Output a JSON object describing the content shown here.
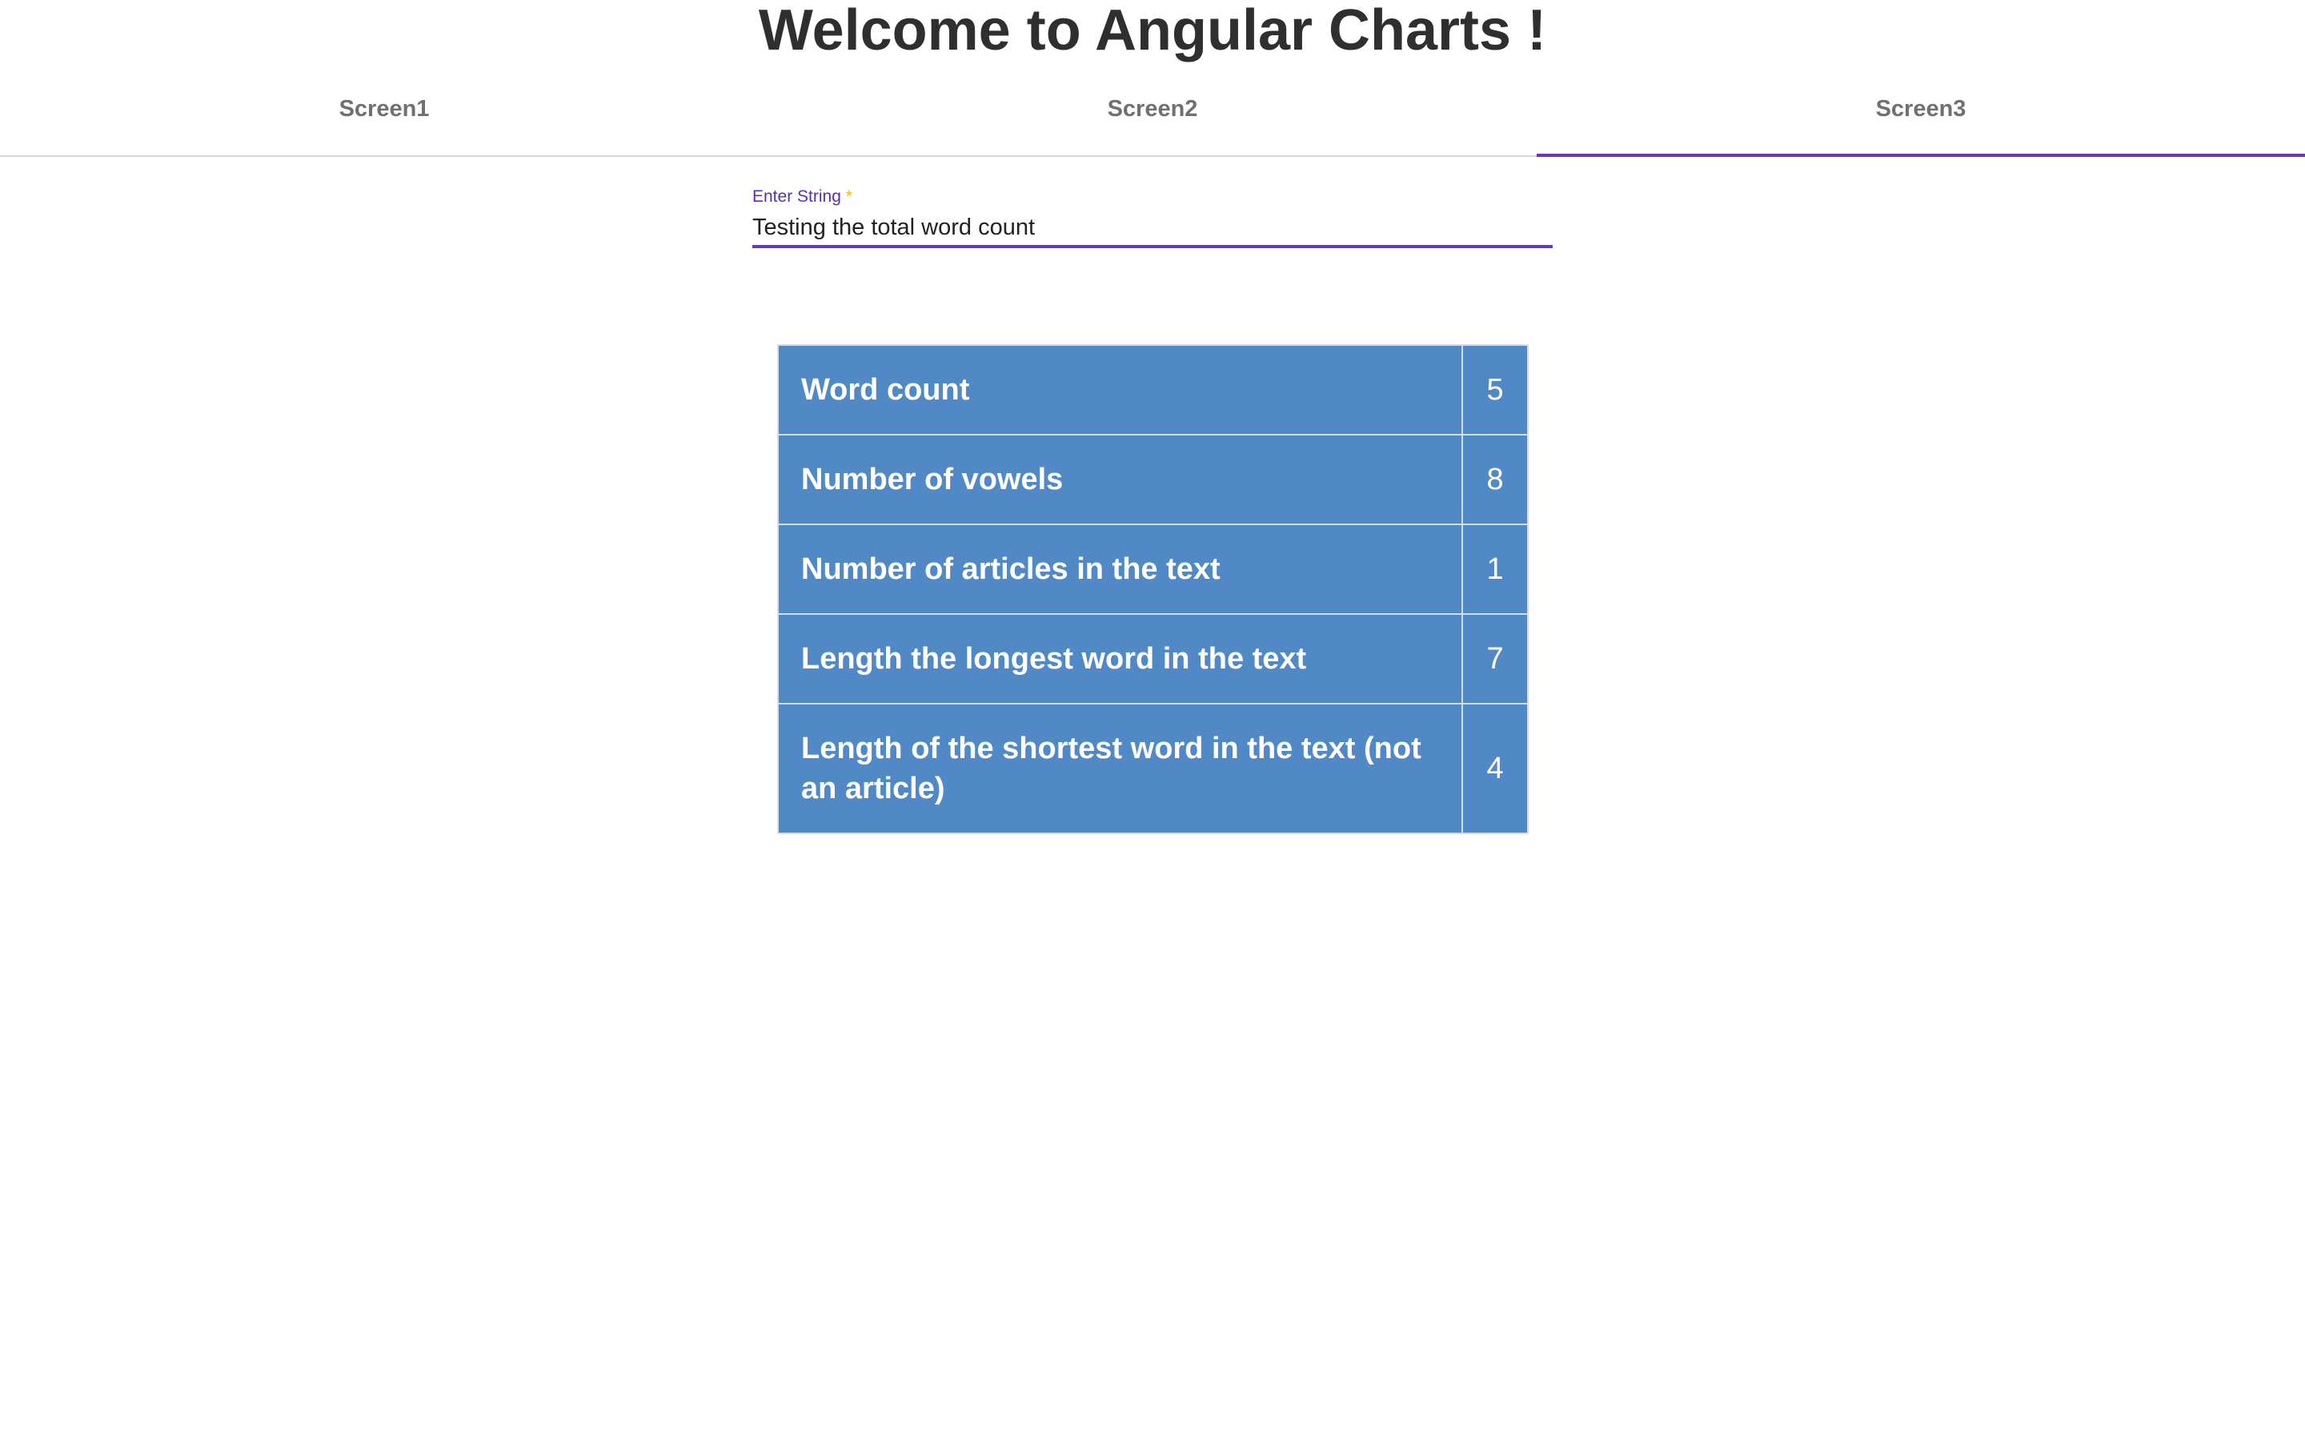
{
  "header": {
    "title": "Welcome to Angular Charts !"
  },
  "tabs": [
    {
      "label": "Screen1",
      "active": false
    },
    {
      "label": "Screen2",
      "active": false
    },
    {
      "label": "Screen3",
      "active": true
    }
  ],
  "form": {
    "label": "Enter String",
    "required_mark": "*",
    "value": "Testing the total word count"
  },
  "stats": [
    {
      "label": "Word count",
      "value": "5"
    },
    {
      "label": "Number of vowels",
      "value": "8"
    },
    {
      "label": "Number of articles in the text",
      "value": "1"
    },
    {
      "label": "Length the longest word in the text",
      "value": "7"
    },
    {
      "label": "Length of the shortest word in the text (not an article)",
      "value": "4"
    }
  ],
  "colors": {
    "accent": "#673ab7",
    "table_bg": "#5189c6",
    "required": "#f2b900"
  }
}
